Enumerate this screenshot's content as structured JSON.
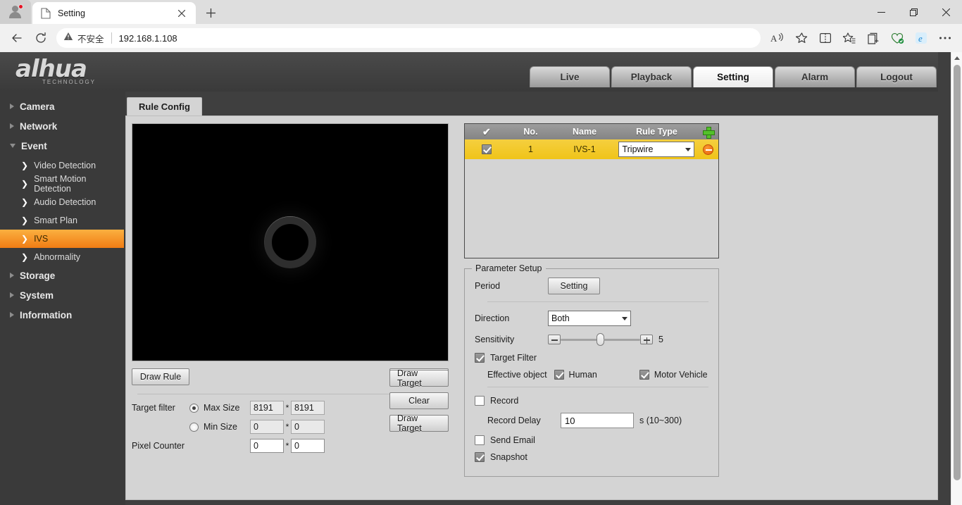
{
  "browser": {
    "tab": {
      "title": "Setting",
      "favicon_icon": "page-icon",
      "close_icon": "close-icon"
    },
    "newtab_icon": "plus-icon",
    "profile_icon": "profile-avatar-icon",
    "window_controls": {
      "minimize": "minimize-icon",
      "maximize": "maximize-icon",
      "close": "close-icon"
    },
    "nav": {
      "back_icon": "back-arrow-icon",
      "reload_icon": "reload-icon"
    },
    "omnibox": {
      "security_icon": "warning-triangle-icon",
      "security_text": "不安全",
      "url": "192.168.1.108"
    },
    "toolbar_right": [
      {
        "name": "read-aloud-icon",
        "glyph": "A"
      },
      {
        "name": "favorite-star-icon",
        "glyph": "☆"
      },
      {
        "name": "split-screen-icon",
        "glyph": "◫"
      },
      {
        "name": "favorites-list-icon",
        "glyph": "☆"
      },
      {
        "name": "collections-icon",
        "glyph": "⊞"
      },
      {
        "name": "browser-essentials-icon",
        "glyph": "♡"
      },
      {
        "name": "ie-mode-icon",
        "glyph": "e"
      },
      {
        "name": "settings-more-icon",
        "glyph": "⋯"
      }
    ]
  },
  "app": {
    "logo": {
      "word": "alhua",
      "sub": "TECHNOLOGY"
    },
    "topnav": [
      {
        "label": "Live",
        "active": false
      },
      {
        "label": "Playback",
        "active": false
      },
      {
        "label": "Setting",
        "active": true
      },
      {
        "label": "Alarm",
        "active": false
      },
      {
        "label": "Logout",
        "active": false
      }
    ]
  },
  "sidebar": {
    "items": [
      {
        "label": "Camera",
        "level": 1,
        "expanded": false
      },
      {
        "label": "Network",
        "level": 1,
        "expanded": false
      },
      {
        "label": "Event",
        "level": 1,
        "expanded": true
      }
    ],
    "event_children": [
      {
        "label": "Video Detection",
        "active": false
      },
      {
        "label": "Smart Motion Detection",
        "active": false
      },
      {
        "label": "Audio Detection",
        "active": false
      },
      {
        "label": "Smart Plan",
        "active": false
      },
      {
        "label": "IVS",
        "active": true
      },
      {
        "label": "Abnormality",
        "active": false
      }
    ],
    "items_after": [
      {
        "label": "Storage",
        "level": 1,
        "expanded": false
      },
      {
        "label": "System",
        "level": 1,
        "expanded": false
      },
      {
        "label": "Information",
        "level": 1,
        "expanded": false
      }
    ]
  },
  "content": {
    "tab_label": "Rule Config",
    "video": {
      "alt": "live-preview-dark-scene-with-ring"
    },
    "left_controls": {
      "draw_rule_button": "Draw Rule",
      "clear_button_top": "Clear",
      "target_filter_label": "Target filter",
      "max_size_label": "Max Size",
      "max_size_w": "8191",
      "max_size_h": "8191",
      "min_size_label": "Min Size",
      "min_size_w": "0",
      "min_size_h": "0",
      "pixel_counter_label": "Pixel Counter",
      "pixel_counter_w": "0",
      "pixel_counter_h": "0",
      "multiply_symbol": "*",
      "draw_target_button_1": "Draw Target",
      "clear_button_2": "Clear",
      "draw_target_button_2": "Draw Target",
      "max_size_selected": true
    },
    "rule_table": {
      "headers": {
        "check": "✔",
        "no": "No.",
        "name": "Name",
        "type": "Rule Type"
      },
      "add_icon": "add-plus-icon",
      "rows": [
        {
          "checked": true,
          "no": "1",
          "name": "IVS-1",
          "rule_type": "Tripwire",
          "delete_icon": "delete-minus-icon"
        }
      ]
    },
    "parameter_setup": {
      "legend": "Parameter Setup",
      "period_label": "Period",
      "period_button": "Setting",
      "direction_label": "Direction",
      "direction_value": "Both",
      "sensitivity_label": "Sensitivity",
      "sensitivity_value": "5",
      "sensitivity_minus_icon": "minus-button-icon",
      "sensitivity_plus_icon": "plus-button-icon",
      "target_filter_label": "Target Filter",
      "target_filter_checked": true,
      "effective_object_label": "Effective object",
      "human_label": "Human",
      "human_checked": true,
      "motor_vehicle_label": "Motor Vehicle",
      "motor_vehicle_checked": true,
      "record_label": "Record",
      "record_checked": false,
      "record_delay_label": "Record Delay",
      "record_delay_value": "10",
      "record_delay_unit": "s (10~300)",
      "send_email_label": "Send Email",
      "send_email_checked": false,
      "snapshot_label": "Snapshot",
      "snapshot_checked": true
    }
  },
  "scrollbar": {
    "up_arrow_icon": "scroll-up-arrow-icon"
  },
  "colors": {
    "accent_orange": "#f07c14",
    "row_yellow": "#f0c419",
    "panel_grey": "#d4d4d4",
    "chrome_dark": "#3f3f3f",
    "add_green": "#53c12a",
    "delete_orange": "#e8610c"
  }
}
